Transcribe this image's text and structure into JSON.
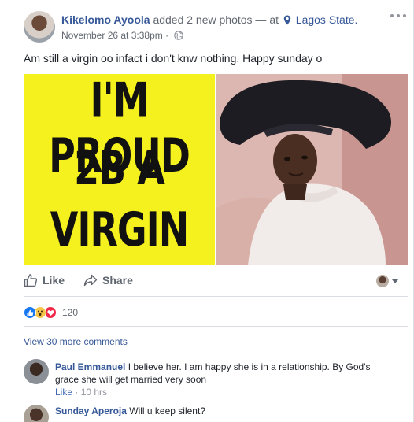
{
  "post": {
    "author": "Kikelomo Ayoola",
    "action": "added 2 new photos — at",
    "location": "Lagos State.",
    "timestamp": "November 26 at 3:38pm ·",
    "text": "Am still a virgin oo infact i don't knw nothing. Happy sunday o",
    "poster_lines": [
      "I'M PROUD",
      "2B A",
      "VIRGIN"
    ]
  },
  "actions": {
    "like_label": "Like",
    "share_label": "Share"
  },
  "reactions": {
    "types": [
      "like",
      "wow",
      "love"
    ],
    "count": "120"
  },
  "comments_link": "View 30 more comments",
  "comments": [
    {
      "name": "Paul Emmanuel",
      "text": "I believe her. I am happy she is in a relationship. By God's grace she will get married very soon",
      "like_label": "Like",
      "time": "10 hrs"
    },
    {
      "name": "Sunday Aperoja",
      "text": "Will u keep silent?"
    }
  ],
  "colors": {
    "link_blue": "#365899",
    "poster_yellow": "#f5f11e",
    "like_blue": "#1877f2",
    "love_red": "#f0284a",
    "wow_yellow": "#f7c64b"
  },
  "icons": [
    "globe-icon",
    "location-pin-icon",
    "more-options-icon",
    "like-thumb-icon",
    "share-arrow-icon"
  ]
}
